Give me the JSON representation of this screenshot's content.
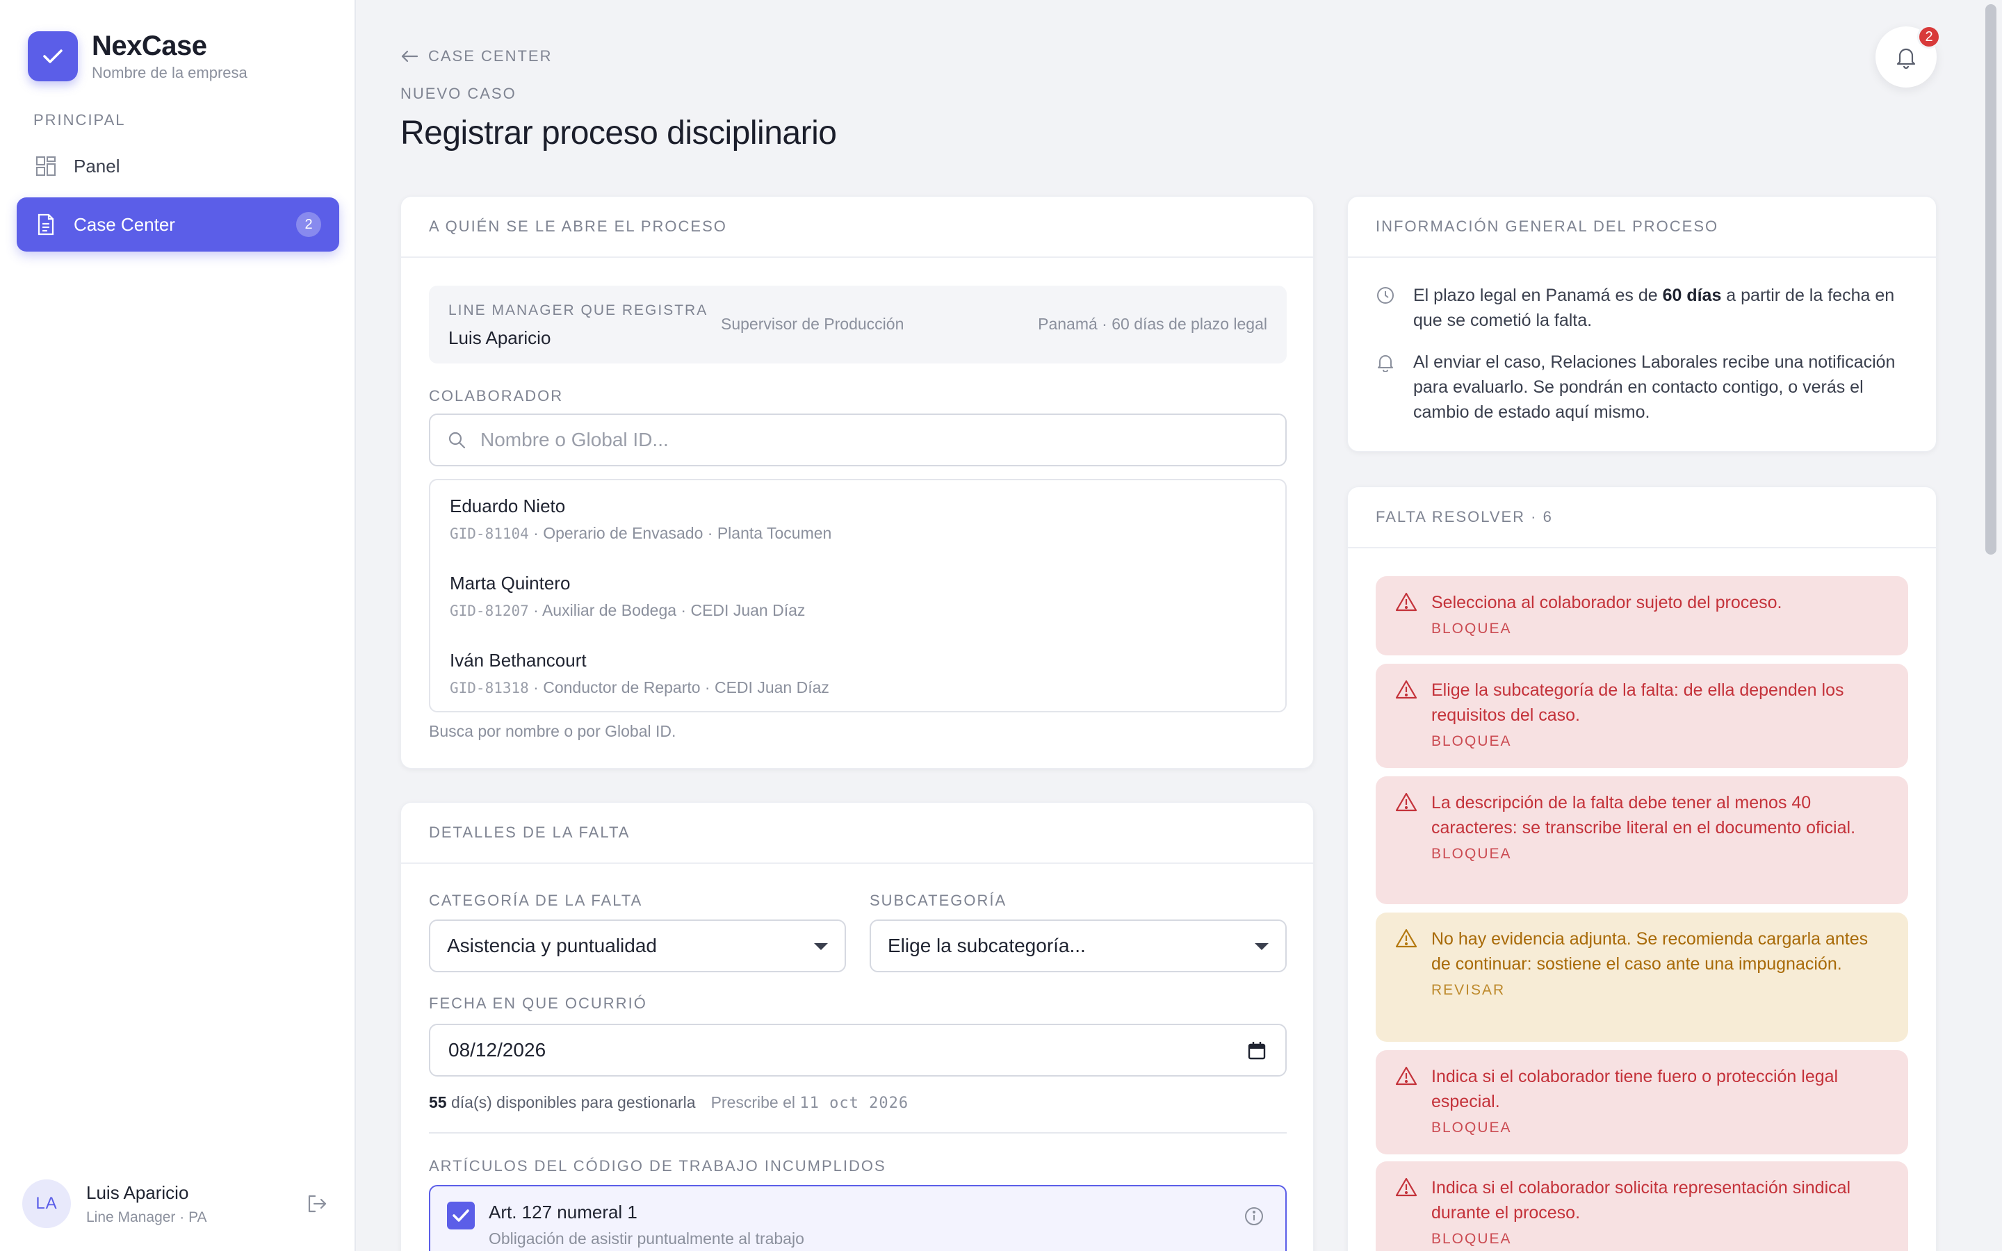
{
  "colors": {
    "accent": "#5b5ee8",
    "danger": "#c4323a",
    "warning": "#a86a08",
    "badge": "#d83a3a"
  },
  "brand": {
    "name": "NexCase",
    "subtitle": "Nombre de la empresa",
    "logo_icon": "check-icon"
  },
  "sidebar": {
    "section_label": "PRINCIPAL",
    "items": [
      {
        "label": "Panel",
        "icon": "grid-icon",
        "active": false
      },
      {
        "label": "Case Center",
        "icon": "document-icon",
        "active": true,
        "badge": "2"
      }
    ],
    "user": {
      "initials": "LA",
      "name": "Luis Aparicio",
      "role": "Line Manager · PA"
    }
  },
  "header": {
    "back_label": "CASE CENTER",
    "eyebrow": "NUEVO CASO",
    "title": "Registrar proceso disciplinario",
    "notifications_count": "2"
  },
  "subject_card": {
    "title": "A QUIÉN SE LE ABRE EL PROCESO",
    "line_manager_label": "LINE MANAGER QUE REGISTRA",
    "line_manager_name": "Luis Aparicio",
    "line_manager_role": "Supervisor de Producción",
    "legal_note": "Panamá · 60 días de plazo legal",
    "collaborator_label": "COLABORADOR",
    "search_placeholder": "Nombre o Global ID...",
    "results": [
      {
        "name": "Eduardo Nieto",
        "gid": "GID-81104",
        "meta": " · Operario de Envasado · Planta Tocumen"
      },
      {
        "name": "Marta Quintero",
        "gid": "GID-81207",
        "meta": " · Auxiliar de Bodega · CEDI Juan Díaz"
      },
      {
        "name": "Iván Bethancourt",
        "gid": "GID-81318",
        "meta": " · Conductor de Reparto · CEDI Juan Díaz"
      }
    ],
    "hint": "Busca por nombre o por Global ID."
  },
  "details_card": {
    "title": "DETALLES DE LA FALTA",
    "category_label": "CATEGORÍA DE LA FALTA",
    "category_value": "Asistencia y puntualidad",
    "subcategory_label": "SUBCATEGORÍA",
    "subcategory_value": "Elige la subcategoría...",
    "date_label": "FECHA EN QUE OCURRIÓ",
    "date_value": "08/12/2026",
    "days_count": "55",
    "days_text": " día(s) disponibles para gestionarla",
    "prescribe_prefix": "Prescribe el ",
    "prescribe_date": "11 oct 2026",
    "articles_label": "ARTÍCULOS DEL CÓDIGO DE TRABAJO INCUMPLIDOS",
    "articles": [
      {
        "title": "Art. 127 numeral 1",
        "description": "Obligación de asistir puntualmente al trabajo",
        "checked": true
      }
    ]
  },
  "info_card": {
    "title": "INFORMACIÓN GENERAL DEL PROCESO",
    "item1_pre": "El plazo legal en Panamá es de ",
    "item1_bold": "60 días",
    "item1_post": " a partir de la fecha en que se cometió la falta.",
    "item2": "Al enviar el caso, Relaciones Laborales recibe una notificación para evaluarlo. Se pondrán en contacto contigo, o verás el cambio de estado aquí mismo."
  },
  "pending_card": {
    "title": "FALTA RESOLVER · 6",
    "alerts": [
      {
        "message": "Selecciona al colaborador sujeto del proceso.",
        "tag": "BLOQUEA",
        "level": "error"
      },
      {
        "message": "Elige la subcategoría de la falta: de ella dependen los requisitos del caso.",
        "tag": "BLOQUEA",
        "level": "error"
      },
      {
        "message": "La descripción de la falta debe tener al menos 40 caracteres: se transcribe literal en el documento oficial.",
        "tag": "BLOQUEA",
        "level": "error"
      },
      {
        "message": "No hay evidencia adjunta. Se recomienda cargarla antes de continuar: sostiene el caso ante una impugnación.",
        "tag": "REVISAR",
        "level": "warning"
      },
      {
        "message": "Indica si el colaborador tiene fuero o protección legal especial.",
        "tag": "BLOQUEA",
        "level": "error"
      },
      {
        "message": "Indica si el colaborador solicita representación sindical durante el proceso.",
        "tag": "BLOQUEA",
        "level": "error"
      }
    ]
  }
}
